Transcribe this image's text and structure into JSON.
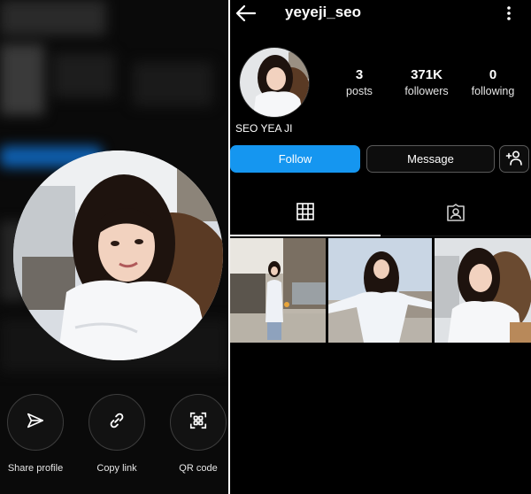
{
  "left_panel": {
    "actions": [
      {
        "label": "Share profile",
        "icon": "send-icon"
      },
      {
        "label": "Copy link",
        "icon": "link-icon"
      },
      {
        "label": "QR code",
        "icon": "qr-code-icon"
      }
    ]
  },
  "profile": {
    "username": "yeyeji_seo",
    "full_name": "SEO YEA JI",
    "stats": [
      {
        "value": "3",
        "label": "posts"
      },
      {
        "value": "371K",
        "label": "followers"
      },
      {
        "value": "0",
        "label": "following"
      }
    ],
    "buttons": {
      "follow": "Follow",
      "message": "Message"
    },
    "tabs": [
      {
        "icon": "grid-icon",
        "active": true
      },
      {
        "icon": "tagged-person-icon",
        "active": false
      }
    ],
    "posts_count": 3
  },
  "colors": {
    "background": "#000000",
    "accent": "#1596f0",
    "border": "#5a5a5a",
    "text": "#ffffff"
  }
}
